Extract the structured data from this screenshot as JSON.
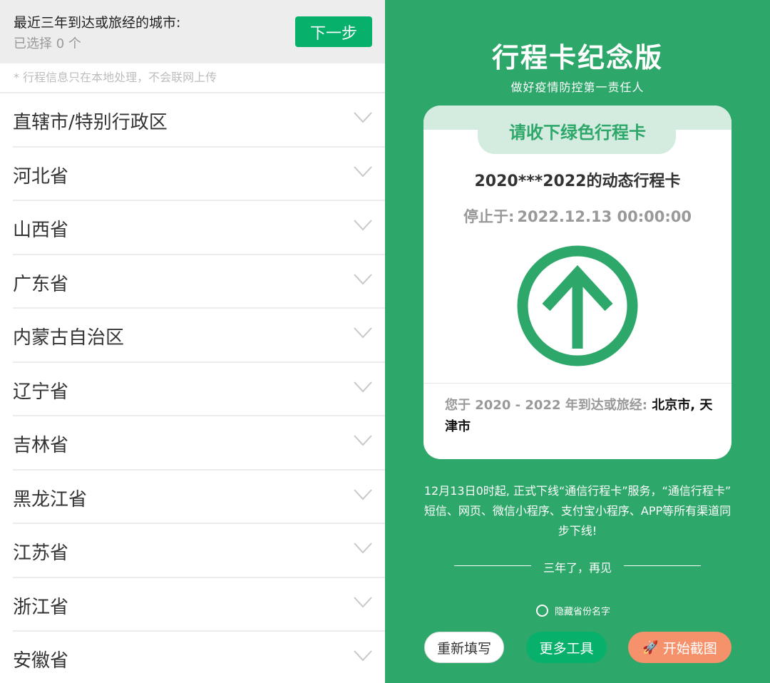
{
  "selector": {
    "title": "最近三年到达或旅经的城市:",
    "selected_count": "已选择 0 个",
    "next_label": "下一步",
    "notice": "* 行程信息只在本地处理，不会联网上传"
  },
  "regions": [
    {
      "label": "直辖市/特别行政区"
    },
    {
      "label": "河北省"
    },
    {
      "label": "山西省"
    },
    {
      "label": "广东省"
    },
    {
      "label": "内蒙古自治区"
    },
    {
      "label": "辽宁省"
    },
    {
      "label": "吉林省"
    },
    {
      "label": "黑龙江省"
    },
    {
      "label": "江苏省"
    },
    {
      "label": "浙江省"
    },
    {
      "label": "安徽省"
    }
  ],
  "card": {
    "page_title": "行程卡纪念版",
    "page_subtitle": "做好疫情防控第一责任人",
    "tab_label": "请收下绿色行程卡",
    "heading": "2020***2022的动态行程卡",
    "stop_label": "停止于:",
    "stop_time": "2022.12.13 00:00:00",
    "route_prefix": "您于 2020 - 2022 年到达或旅经:",
    "route_cities": "北京市, 天津市",
    "status_color": "#2ea76a"
  },
  "footer": {
    "description": "12月13日0时起, 正式下线“通信行程卡”服务，“通信行程卡” 短信、网页、微信小程序、支付宝小程序、APP等所有渠道同步下线!",
    "farewell": "三年了，再见",
    "hide_province_label": "隐藏省份名字",
    "refill_label": "重新填写",
    "more_tools_label": "更多工具",
    "screenshot_label": "开始截图",
    "screenshot_icon": "rocket-icon"
  },
  "colors": {
    "accent_green": "#07b06b",
    "panel_green": "#2ea76a",
    "screenshot_orange": "#f5926c"
  }
}
